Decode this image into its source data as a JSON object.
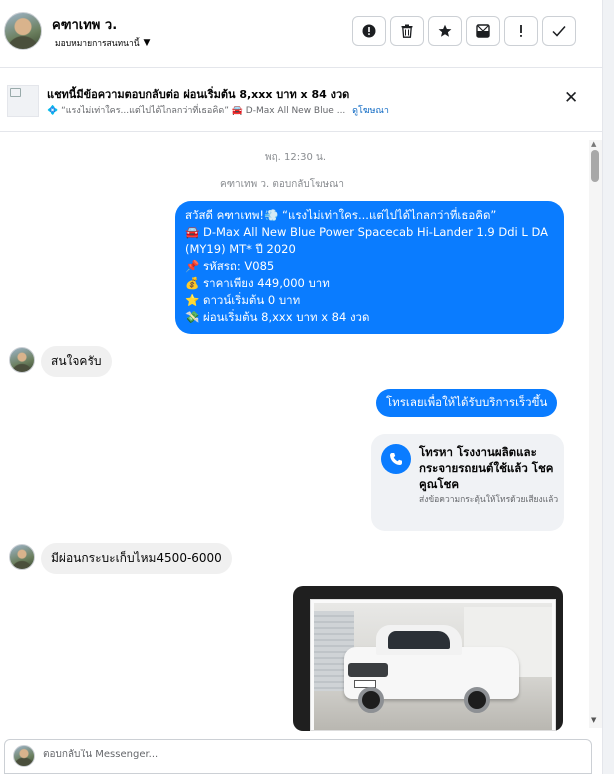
{
  "header": {
    "contact_name": "คฑาเทพ ว.",
    "assign_label": "มอบหมายการสนทนานี้",
    "actions": [
      {
        "icon": "alert-circle-icon",
        "glyph": "!"
      },
      {
        "icon": "trash-icon",
        "glyph": "🗑"
      },
      {
        "icon": "star-icon",
        "glyph": "★"
      },
      {
        "icon": "archive-icon",
        "glyph": "⊠"
      },
      {
        "icon": "exclamation-icon",
        "glyph": "!"
      },
      {
        "icon": "checkmark-icon",
        "glyph": "✓"
      }
    ]
  },
  "banner": {
    "title": "แชทนี้มีข้อความตอบกลับต่อ ผ่อนเริ่มต้น 8,xxx บาท x 84 งวด",
    "subtitle": "💠 “แรงไม่เท่าใคร...แต่ไปได้ไกลกว่าที่เธอคิด” 🚘 D-Max All New Blue ...",
    "link": "ดูโฆษณา",
    "close_glyph": "✕"
  },
  "thread": {
    "timestamp": "พฤ. 12:30 น.",
    "reply_note": "คฑาเทพ ว. ตอบกลับโฆษณา",
    "ad_message_lines": [
      "สวัสดี คฑาเทพ!💨 “แรงไม่เท่าใคร...แต่ไปได้ไกลกว่าที่เธอคิด”",
      "🚘 D-Max All New Blue Power Spacecab Hi-Lander 1.9 Ddi L DA",
      "(MY19) MT* ปี 2020",
      "📌 รหัสรถ: V085",
      "💰 ราคาเพียง 449,000 บาท",
      "⭐ ดาวน์เริ่มต้น 0 บาท",
      "💸 ผ่อนเริ่มต้น 8,xxx บาท x 84 งวด"
    ],
    "incoming_1": "สนใจครับ",
    "outgoing_cta": "โทรเลยเพื่อให้ได้รับบริการเร็วขึ้น",
    "call_card": {
      "title": "โทรหา โรงงานผลิตและกระจายรถยนต์ใช้แล้ว โชคคูณโชค",
      "subtitle": "ส่งข้อความกระตุ้นให้โทรด้วยเสียงแล้ว"
    },
    "incoming_2": "มีผ่อนกระบะเก็บไหม4500-6000"
  },
  "reply": {
    "placeholder": "ตอบกลับใน Messenger..."
  }
}
